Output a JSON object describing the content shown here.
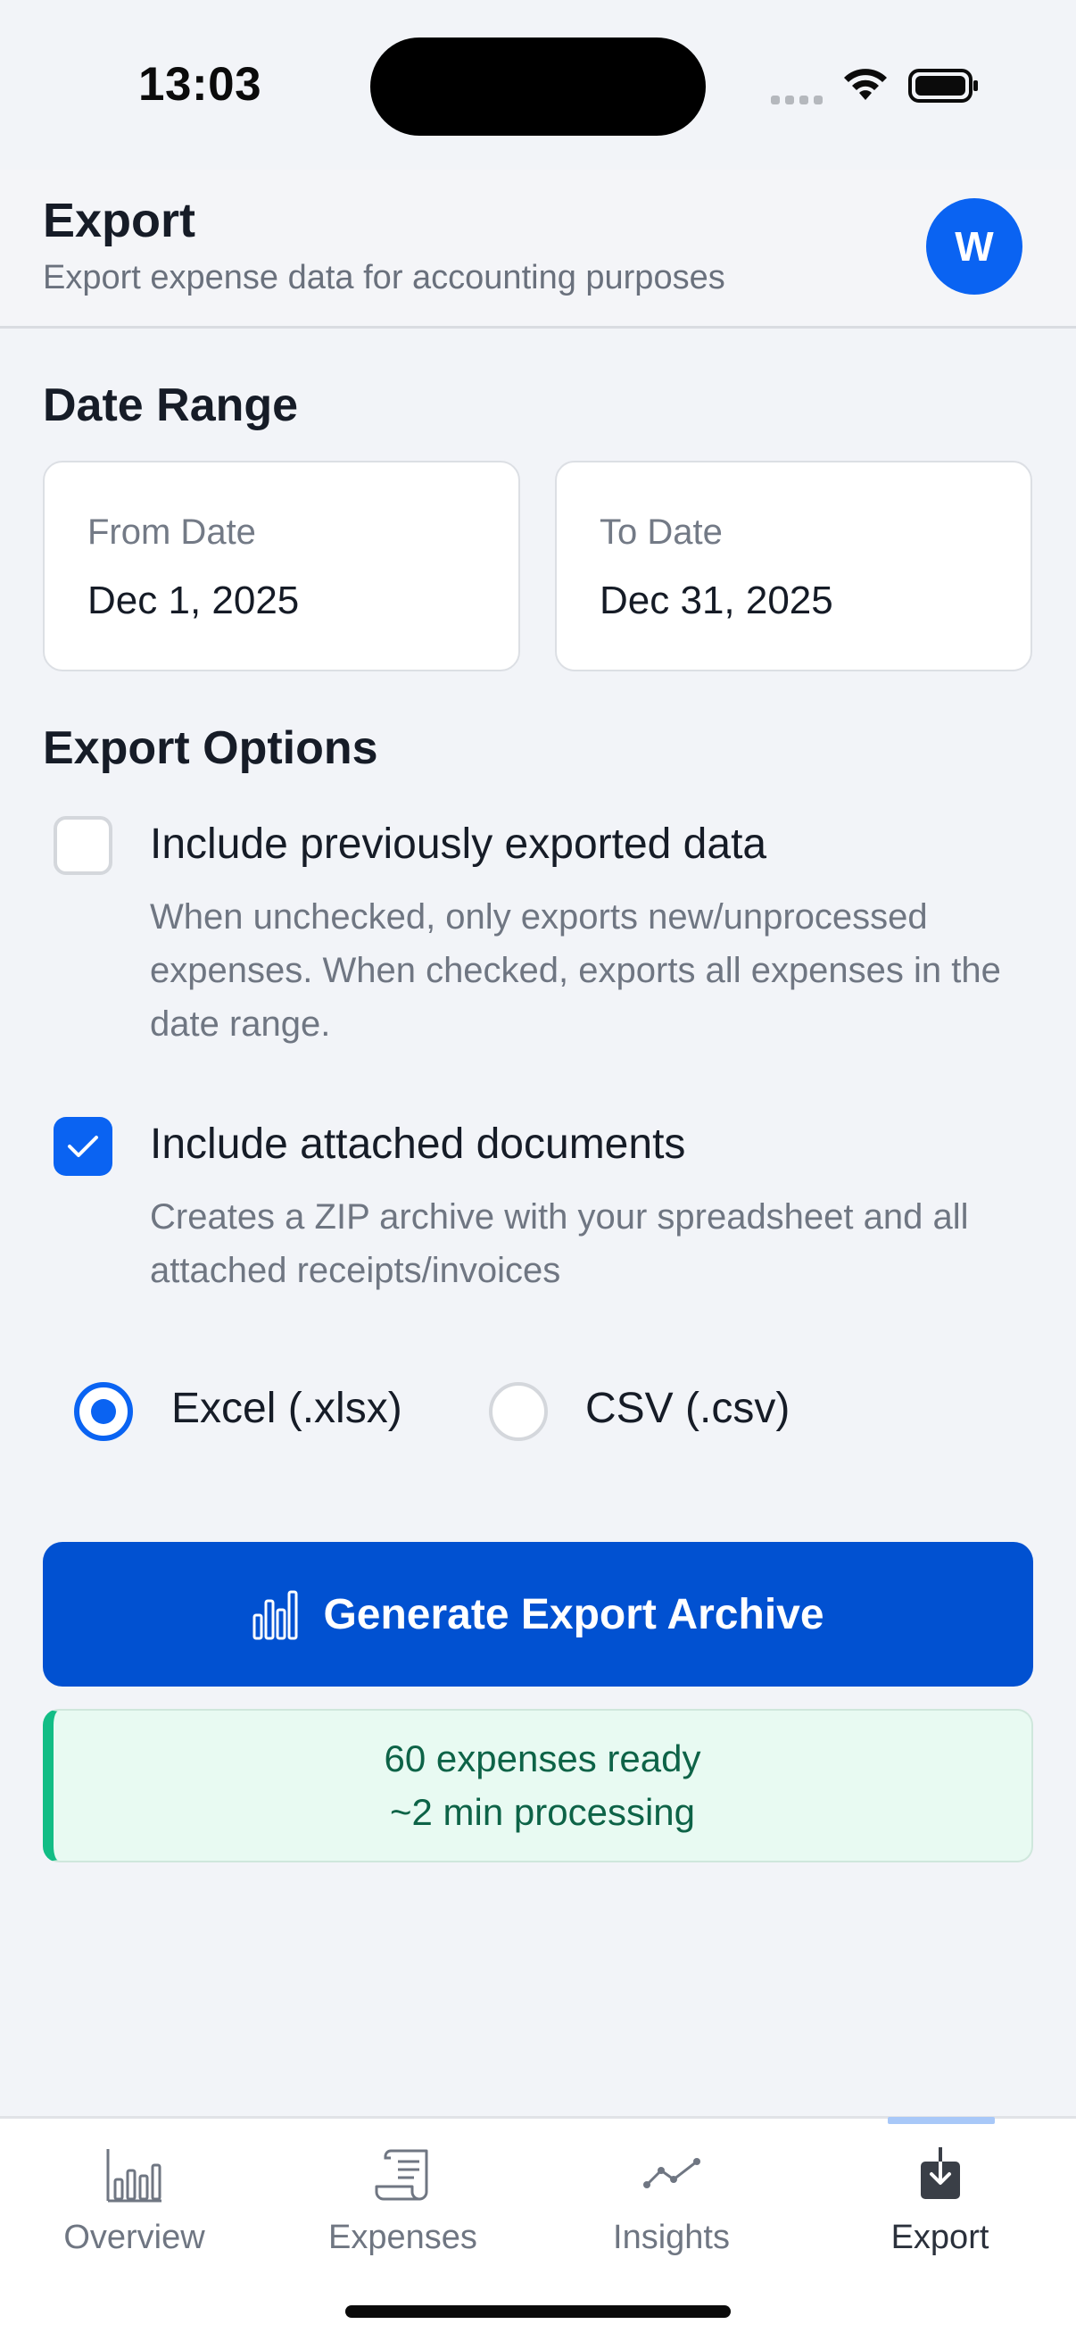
{
  "status_bar": {
    "time": "13:03"
  },
  "header": {
    "title": "Export",
    "subtitle": "Export expense data for accounting purposes",
    "avatar_initial": "W"
  },
  "date_range": {
    "heading": "Date Range",
    "from": {
      "label": "From Date",
      "value": "Dec 1, 2025"
    },
    "to": {
      "label": "To Date",
      "value": "Dec 31, 2025"
    }
  },
  "export_options": {
    "heading": "Export Options",
    "include_previous": {
      "label": "Include previously exported data",
      "description": "When unchecked, only exports new/unprocessed expenses. When checked, exports all expenses in the date range.",
      "checked": false
    },
    "include_documents": {
      "label": "Include attached documents",
      "description": "Creates a ZIP archive with your spreadsheet and all attached receipts/invoices",
      "checked": true
    },
    "format": {
      "options": [
        {
          "label": "Excel (.xlsx)",
          "selected": true
        },
        {
          "label": "CSV (.csv)",
          "selected": false
        }
      ]
    }
  },
  "generate_button": {
    "label": "Generate Export Archive",
    "icon": "bar-chart-icon"
  },
  "status": {
    "line1": "60 expenses ready",
    "line2": "~2 min processing"
  },
  "bottom_nav": {
    "items": [
      {
        "label": "Overview",
        "icon": "bar-chart-icon",
        "active": false
      },
      {
        "label": "Expenses",
        "icon": "receipt-icon",
        "active": false
      },
      {
        "label": "Insights",
        "icon": "trend-line-icon",
        "active": false
      },
      {
        "label": "Export",
        "icon": "download-icon",
        "active": true
      }
    ]
  },
  "colors": {
    "accent": "#0a63f2",
    "button": "#0151d1",
    "success_border": "#12bd85",
    "success_bg": "#e8faf2",
    "success_text": "#0d6347"
  }
}
